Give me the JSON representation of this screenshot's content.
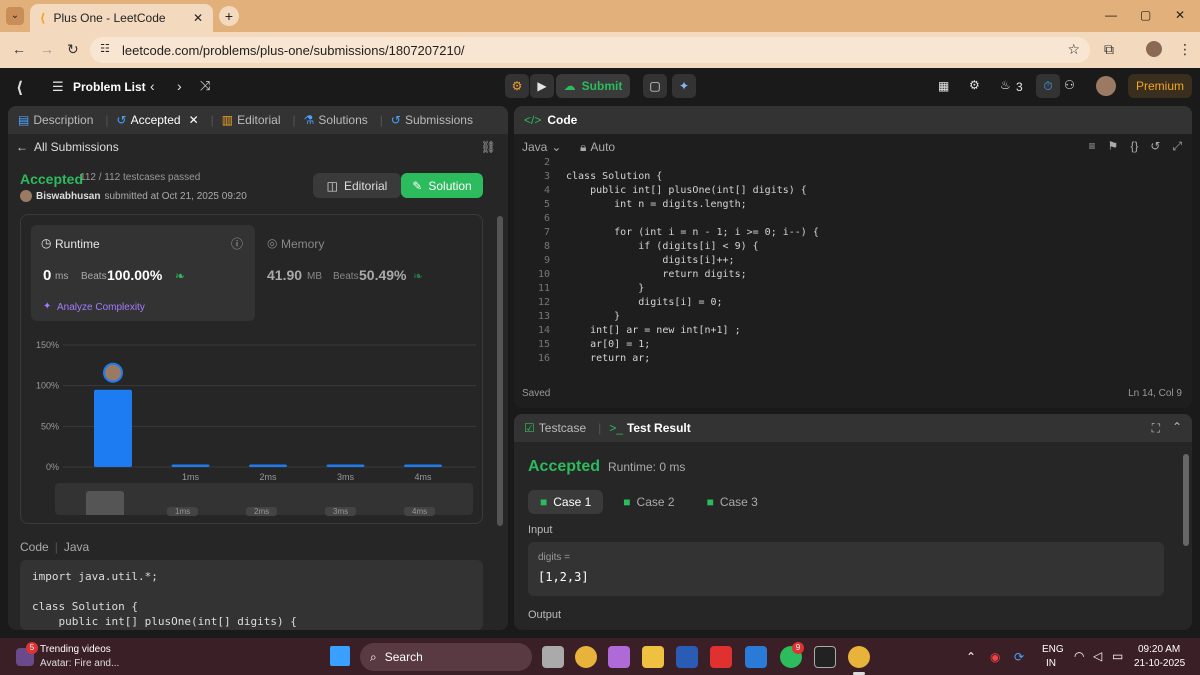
{
  "browser": {
    "tab_title": "Plus One - LeetCode",
    "url": "leetcode.com/problems/plus-one/submissions/1807207210/"
  },
  "nav": {
    "problem_list": "Problem List",
    "submit": "Submit",
    "streak": "3",
    "premium": "Premium"
  },
  "left": {
    "tabs": [
      "Description",
      "Accepted",
      "Editorial",
      "Solutions",
      "Submissions"
    ],
    "all_submissions": "All Submissions",
    "status": "Accepted",
    "testcases": "112 / 112 testcases passed",
    "user": "Biswabhusan",
    "submitted": "submitted at Oct 21, 2025 09:20",
    "editorial_btn": "Editorial",
    "solution_btn": "Solution",
    "runtime_label": "Runtime",
    "runtime_value": "0",
    "runtime_unit": "ms",
    "beats": "Beats",
    "runtime_beats": "100.00%",
    "memory_label": "Memory",
    "memory_value": "41.90",
    "memory_unit": "MB",
    "memory_beats": "50.49%",
    "analyze": "Analyze Complexity",
    "code_label": "Code",
    "lang": "Java",
    "code_lines": [
      "import java.util.*;",
      "",
      "class Solution {",
      "    public int[] plusOne(int[] digits) {"
    ]
  },
  "chart_data": {
    "type": "bar",
    "categories": [
      "",
      "1ms",
      "2ms",
      "3ms",
      "4ms"
    ],
    "values": [
      95,
      3,
      3,
      3,
      3
    ],
    "y_ticks": [
      "150%",
      "100%",
      "50%",
      "0%"
    ],
    "ylim": [
      0,
      150
    ]
  },
  "editor": {
    "title": "Code",
    "lang": "Java",
    "mode": "Auto",
    "saved": "Saved",
    "cursor": "Ln 14, Col 9"
  },
  "code": [
    {
      "n": "2",
      "t": ""
    },
    {
      "n": "3",
      "t": "class Solution {"
    },
    {
      "n": "4",
      "t": "    public int[] plusOne(int[] digits) {"
    },
    {
      "n": "5",
      "t": "        int n = digits.length;"
    },
    {
      "n": "6",
      "t": ""
    },
    {
      "n": "7",
      "t": "        for (int i = n - 1; i >= 0; i--) {"
    },
    {
      "n": "8",
      "t": "            if (digits[i] < 9) {"
    },
    {
      "n": "9",
      "t": "                digits[i]++;"
    },
    {
      "n": "10",
      "t": "                return digits;"
    },
    {
      "n": "11",
      "t": "            }"
    },
    {
      "n": "12",
      "t": "            digits[i] = 0;"
    },
    {
      "n": "13",
      "t": "        }"
    },
    {
      "n": "14",
      "t": "    int[] ar = new int[n+1] ;"
    },
    {
      "n": "15",
      "t": "    ar[0] = 1;"
    },
    {
      "n": "16",
      "t": "    return ar;"
    }
  ],
  "result": {
    "tab_testcase": "Testcase",
    "tab_result": "Test Result",
    "status": "Accepted",
    "runtime": "Runtime: 0 ms",
    "cases": [
      "Case 1",
      "Case 2",
      "Case 3"
    ],
    "input_label": "Input",
    "var": "digits =",
    "value": "[1,2,3]",
    "output_label": "Output"
  },
  "taskbar": {
    "trending": "Trending videos",
    "trending_sub": "Avatar: Fire and...",
    "search": "Search",
    "lang1": "ENG",
    "lang2": "IN",
    "time": "09:20 AM",
    "date": "21-10-2025",
    "badge": "5",
    "badge2": "9"
  }
}
